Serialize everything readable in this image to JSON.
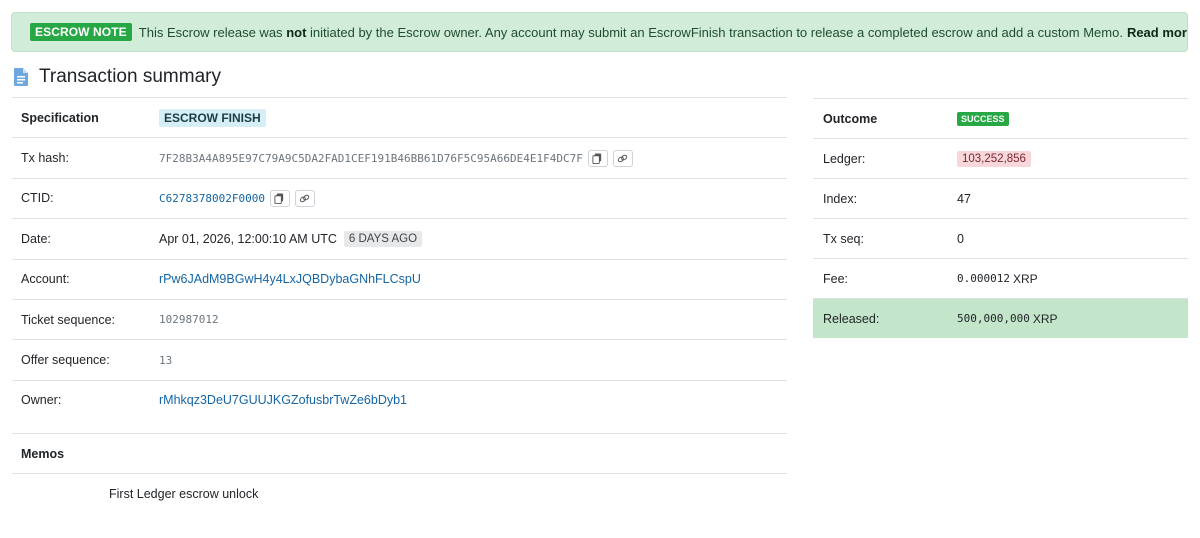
{
  "notice": {
    "badge": "ESCROW NOTE",
    "text_before": "This Escrow release was",
    "text_bold": "not",
    "text_after": "initiated by the Escrow owner. Any account may submit an EscrowFinish transaction to release a completed escrow and add a custom Memo.",
    "read_more": "Read more →",
    "color": "#28a745"
  },
  "header": {
    "title": "Transaction summary",
    "icon": "document-icon"
  },
  "left": {
    "specification_label": "Specification",
    "specification_value": "ESCROW FINISH",
    "rows": {
      "tx_hash_label": "Tx hash:",
      "tx_hash_value": "7F28B3A4A895E97C79A9C5DA2FAD1CEF191B46BB61D76F5C95A66DE4E1F4DC7F",
      "ctid_label": "CTID:",
      "ctid_value": "C6278378002F0000",
      "date_label": "Date:",
      "date_value": "Apr 01, 2026, 12:00:10 AM UTC",
      "date_relative": "6 DAYS AGO",
      "account_label": "Account:",
      "account_value": "rPw6JAdM9BGwH4y4LxJQBDybaGNhFLCspU",
      "ticket_label": "Ticket sequence:",
      "ticket_value": "102987012",
      "offer_label": "Offer sequence:",
      "offer_value": "13",
      "owner_label": "Owner:",
      "owner_value": "rMhkqz3DeU7GUUJKGZofusbrTwZe6bDyb1"
    },
    "icons": {
      "copy": "copy-icon",
      "link": "link-icon"
    }
  },
  "memos": {
    "label": "Memos",
    "text": "First Ledger escrow unlock"
  },
  "right": {
    "outcome_label": "Outcome",
    "outcome_value": "SUCCESS",
    "ledger_label": "Ledger:",
    "ledger_value": "103,252,856",
    "index_label": "Index:",
    "index_value": "47",
    "txseq_label": "Tx seq:",
    "txseq_value": "0",
    "fee_label": "Fee:",
    "fee_value": "0.000012",
    "fee_unit": "XRP",
    "released_label": "Released:",
    "released_value": "500,000,000",
    "released_unit": "XRP"
  }
}
